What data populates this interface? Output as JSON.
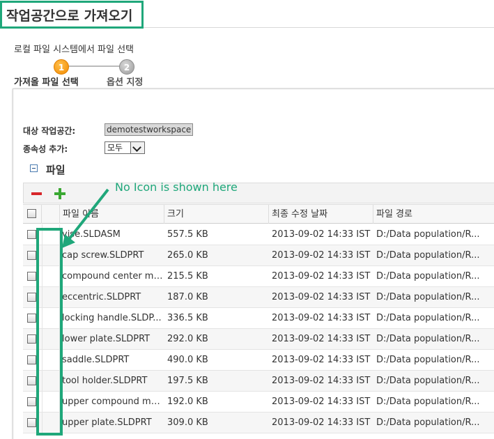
{
  "title": "작업공간으로 가져오기",
  "wizard": {
    "subtitle": "로컬 파일 시스템에서 파일 선택",
    "steps": [
      {
        "number": "1",
        "label": "가져올 파일 선택"
      },
      {
        "number": "2",
        "label": "옵션 지정"
      }
    ]
  },
  "form": {
    "workspace_label": "대상 작업공간:",
    "workspace_value": "demotestworkspace",
    "dependency_label": "종속성 추가:",
    "dependency_value": "모두"
  },
  "files_section": {
    "title": "파일",
    "columns": [
      "파일 이름",
      "크기",
      "최종 수정 날짜",
      "파일 경로"
    ],
    "rows": [
      {
        "name": "vise.SLDASM",
        "size": "557.5 KB",
        "date": "2013-09-02 14:33 IST",
        "path": "D:/Data population/R..."
      },
      {
        "name": "cap screw.SLDPRT",
        "size": "265.0 KB",
        "date": "2013-09-02 14:33 IST",
        "path": "D:/Data population/R..."
      },
      {
        "name": "compound center me...",
        "size": "215.5 KB",
        "date": "2013-09-02 14:33 IST",
        "path": "D:/Data population/R..."
      },
      {
        "name": "eccentric.SLDPRT",
        "size": "187.0 KB",
        "date": "2013-09-02 14:33 IST",
        "path": "D:/Data population/R..."
      },
      {
        "name": "locking handle.SLDP...",
        "size": "336.5 KB",
        "date": "2013-09-02 14:33 IST",
        "path": "D:/Data population/R..."
      },
      {
        "name": "lower plate.SLDPRT",
        "size": "292.0 KB",
        "date": "2013-09-02 14:33 IST",
        "path": "D:/Data population/R..."
      },
      {
        "name": "saddle.SLDPRT",
        "size": "490.0 KB",
        "date": "2013-09-02 14:33 IST",
        "path": "D:/Data population/R..."
      },
      {
        "name": "tool holder.SLDPRT",
        "size": "197.5 KB",
        "date": "2013-09-02 14:33 IST",
        "path": "D:/Data population/R..."
      },
      {
        "name": "upper compound me...",
        "size": "192.0 KB",
        "date": "2013-09-02 14:33 IST",
        "path": "D:/Data population/R..."
      },
      {
        "name": "upper plate.SLDPRT",
        "size": "309.0 KB",
        "date": "2013-09-02 14:33 IST",
        "path": "D:/Data population/R..."
      }
    ]
  },
  "toolbar_icons": [
    "remove-icon",
    "add-icon"
  ],
  "annotation": {
    "text": "No Icon is shown here",
    "color": "#1fa77a"
  },
  "colors": {
    "step_active": "#f28a00",
    "step_inactive": "#9a9a9a",
    "remove": "#d7262a",
    "add": "#3aa832"
  }
}
